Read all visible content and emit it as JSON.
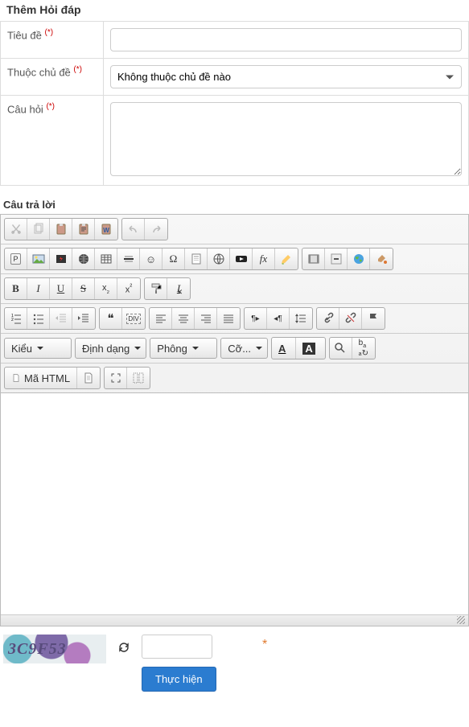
{
  "page_title": "Thêm Hỏi đáp",
  "form": {
    "title_label": "Tiêu đề",
    "title_value": "",
    "category_label": "Thuộc chủ đề",
    "category_selected": "Không thuộc chủ đề nào",
    "question_label": "Câu hỏi",
    "question_value": "",
    "required_mark": "(*)"
  },
  "answer_section_label": "Câu trả lời",
  "toolbar": {
    "combos": {
      "style": "Kiểu",
      "format": "Định dạng",
      "font": "Phông",
      "size": "Cỡ...",
      "text_color": "A",
      "bg_color": "A"
    },
    "source_btn": "Mã HTML",
    "p_btn": "P",
    "fx_btn": "fx",
    "omega": "Ω",
    "smiley": "☺",
    "div": "DIV",
    "quote": "❝",
    "ltr": "¶▸",
    "rtl": "◂¶"
  },
  "captcha": {
    "code": "3C9F53",
    "input_value": "",
    "required_mark": "*"
  },
  "submit_label": "Thực hiện"
}
